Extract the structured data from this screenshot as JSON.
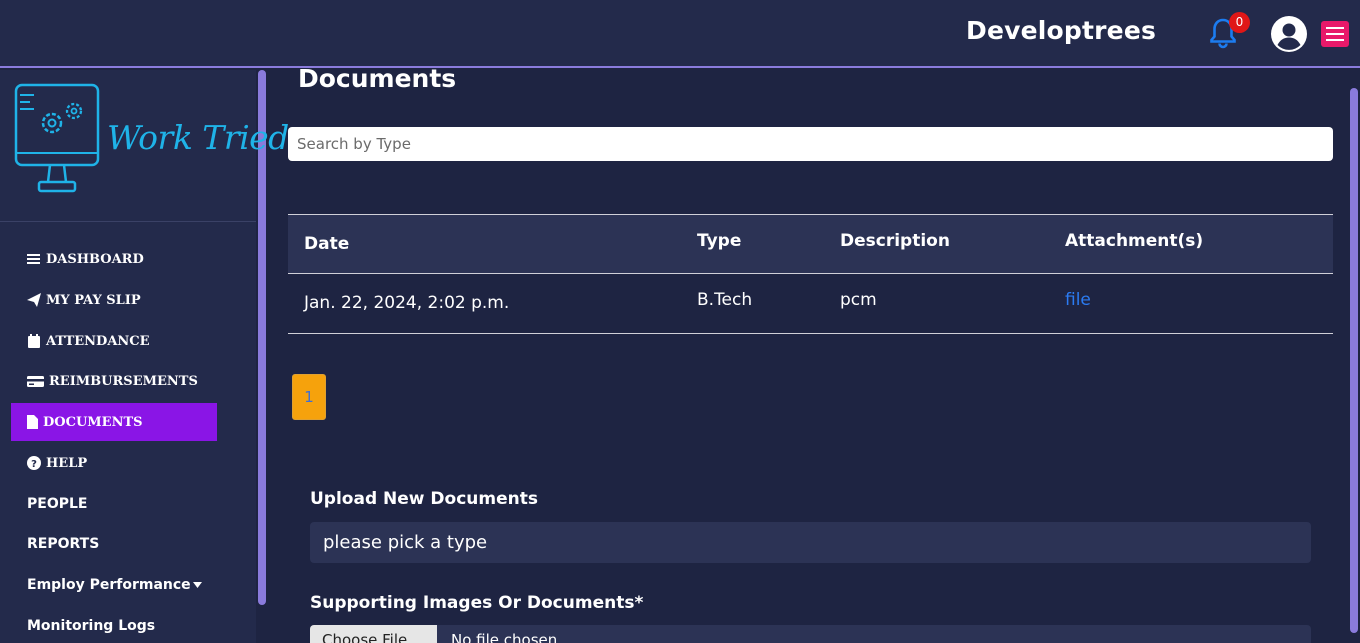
{
  "header": {
    "brand": "Developtrees",
    "notification_count": "0"
  },
  "sidebar": {
    "logo_text": "Work Tried",
    "items": [
      {
        "label": "DASHBOARD",
        "icon": "bars-icon"
      },
      {
        "label": "MY PAY SLIP",
        "icon": "paper-plane-icon"
      },
      {
        "label": "ATTENDANCE",
        "icon": "calendar-icon"
      },
      {
        "label": "REIMBURSEMENTS",
        "icon": "credit-card-icon"
      },
      {
        "label": "DOCUMENTS",
        "icon": "file-icon",
        "active": true
      },
      {
        "label": "HELP",
        "icon": "question-circle-icon"
      },
      {
        "label": "PEOPLE"
      },
      {
        "label": "REPORTS"
      },
      {
        "label": "Employ Performance"
      },
      {
        "label": "Monitoring Logs"
      }
    ]
  },
  "main": {
    "title": "Documents",
    "search": {
      "placeholder": "Search by Type",
      "value": ""
    },
    "table": {
      "columns": [
        "Date",
        "Type",
        "Description",
        "Attachment(s)"
      ],
      "rows": [
        [
          "Jan. 22, 2024, 2:02 p.m.",
          "B.Tech",
          "pcm",
          "file"
        ]
      ]
    },
    "pagination": {
      "current_page": "1"
    },
    "upload": {
      "heading": "Upload New Documents",
      "type_select": "please pick a type",
      "supporting_label": "Supporting Images Or Documents*",
      "file_button": "Choose File",
      "file_status": "No file chosen"
    }
  },
  "colors": {
    "accent": "#8a15e6",
    "link": "#2b7bf2",
    "pager": "#f6a20c",
    "badge": "#e01717",
    "menu": "#e8196a"
  }
}
